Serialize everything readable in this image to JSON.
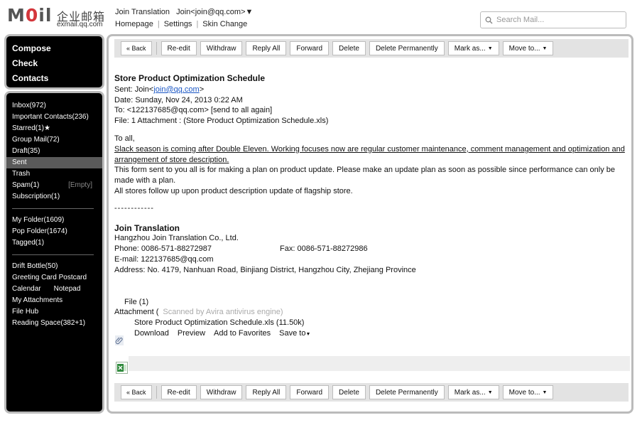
{
  "logo": {
    "mark_left": "M",
    "mark_dot": "0",
    "mark_right": "il",
    "cn_name": "企业邮箱",
    "domain": "exmail.qq.com"
  },
  "header": {
    "user_name": "Join Translation",
    "user_email": "Join<join@qq.com>▼",
    "links": [
      "Homepage",
      "Settings",
      "Skin Change"
    ],
    "search_placeholder": "Search Mail..."
  },
  "sidebar": {
    "top_items": [
      "Compose",
      "Check",
      "Contacts"
    ],
    "inbox": "Inbox(972)",
    "important": "Important Contacts(236)",
    "starred": "Starred(1)★",
    "group_mail": "Group Mail(72)",
    "drafts": "Draft(35)",
    "sent": "Sent",
    "trash": "Trash",
    "spam": "Spam(1)",
    "spam_action": "[Empty]",
    "subscription": "Subscription(1)",
    "my_folder": "My Folder(1609)",
    "pop_folder": "Pop Folder(1674)",
    "tagged": "Tagged(1)",
    "drift_bottle": "Drift Bottle(50)",
    "greeting_card": "Greeting Card Postcard",
    "calendar": "Calendar",
    "notepad": "Notepad",
    "attachments": "My Attachments",
    "file_hub": "File Hub",
    "reading_space": "Reading Space(382+1)"
  },
  "toolbar": {
    "back": "« Back",
    "reedit": "Re-edit",
    "withdraw": "Withdraw",
    "reply_all": "Reply All",
    "forward": "Forward",
    "delete": "Delete",
    "delete_permanently": "Delete Permanently",
    "mark_as": "Mark as...",
    "move_to": "Move to..."
  },
  "email": {
    "subject": "Store Product Optimization Schedule",
    "sent_label": "Sent: Join<",
    "sent_email": "join@qq.com",
    "sent_end": ">",
    "date": "Date: Sunday, Nov 24, 2013 0:22 AM",
    "to": "To:   <122137685@qq.com> [send to all again]",
    "file_line": "File:   1 Attachment : (Store Product Optimization Schedule.xls)",
    "greeting": "To all,",
    "para1": "Slack season is coming after Double Eleven. Working focuses now are regular customer maintenance, comment management and optimization and arrangement of store description.",
    "para2": "This form sent to you all is for making a plan on product update. Please make an update plan as soon as possible since performance can only be made with a plan.",
    "para3": "All stores follow up upon product description update of flagship store.",
    "dashes": "------------",
    "signature": {
      "name": "Join Translation",
      "company": "Hangzhou Join Translation Co., Ltd.",
      "phone": "Phone: 0086-571-88272987",
      "fax": "Fax: 0086-571-88272986",
      "email": "E-mail: 122137685@qq.com",
      "address": "Address: No. 4179, Nanhuan Road, Binjiang District, Hangzhou City, Zhejiang Province"
    }
  },
  "attachment": {
    "file_count": "File (1)",
    "label": "Attachment (",
    "scan": "Scanned by Avira antivirus engine)",
    "name": "Store Product Optimization Schedule.xls (11.50k)",
    "download": "Download",
    "preview": "Preview",
    "add_fav": "Add to Favorites",
    "save_to": "Save to"
  },
  "colors": {
    "sidebar_bg": "#000000",
    "sidebar_active": "#5a5a5a",
    "toolbar_bg": "#e3e3e3",
    "link": "#1a56c4",
    "logo_accent": "#d4373c"
  }
}
